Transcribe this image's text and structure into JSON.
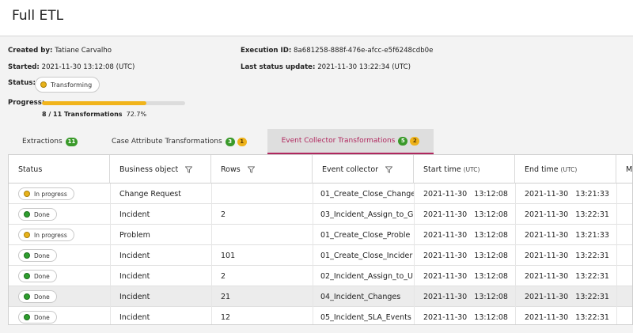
{
  "page": {
    "title": "Full ETL"
  },
  "info": {
    "created_by_label": "Created by:",
    "created_by": "Tatiane Carvalho",
    "started_label": "Started:",
    "started": "2021-11-30  13:12:08 (UTC)",
    "status_label": "Status:",
    "status": "Transforming",
    "progress_label": "Progress:",
    "execution_id_label": "Execution ID:",
    "execution_id": "8a681258-888f-476e-afcc-e5f6248cdb0e",
    "last_update_label": "Last status update:",
    "last_update": "2021-11-30  13:22:34 (UTC)"
  },
  "progress": {
    "fraction": 0.727,
    "count_text": "8 / 11 Transformations",
    "percent_text": "72.7%"
  },
  "tabs": [
    {
      "label": "Extractions",
      "badges": [
        "11"
      ]
    },
    {
      "label": "Case Attribute Transformations",
      "badges": [
        "3",
        "1"
      ]
    },
    {
      "label": "Event Collector Transformations",
      "badges": [
        "5",
        "2"
      ]
    }
  ],
  "table": {
    "headers": [
      "Status",
      "Business object",
      "Rows",
      "Event collector",
      "Start time",
      "End time",
      "Me"
    ],
    "header_unit": "(UTC)",
    "rows": [
      {
        "status": "In progress",
        "business_object": "Change Request",
        "rows": "",
        "event_collector": "01_Create_Close_Change",
        "start": "2021-11-30   13:12:08",
        "end": "2021-11-30   13:21:33"
      },
      {
        "status": "Done",
        "business_object": "Incident",
        "rows": "2",
        "event_collector": "03_Incident_Assign_to_G",
        "start": "2021-11-30   13:12:08",
        "end": "2021-11-30   13:22:31"
      },
      {
        "status": "In progress",
        "business_object": "Problem",
        "rows": "",
        "event_collector": "01_Create_Close_Proble",
        "start": "2021-11-30   13:12:08",
        "end": "2021-11-30   13:21:33"
      },
      {
        "status": "Done",
        "business_object": "Incident",
        "rows": "101",
        "event_collector": "01_Create_Close_Incider",
        "start": "2021-11-30   13:12:08",
        "end": "2021-11-30   13:22:31"
      },
      {
        "status": "Done",
        "business_object": "Incident",
        "rows": "2",
        "event_collector": "02_Incident_Assign_to_U",
        "start": "2021-11-30   13:12:08",
        "end": "2021-11-30   13:22:31"
      },
      {
        "status": "Done",
        "business_object": "Incident",
        "rows": "21",
        "event_collector": "04_Incident_Changes",
        "start": "2021-11-30   13:12:08",
        "end": "2021-11-30   13:22:31"
      },
      {
        "status": "Done",
        "business_object": "Incident",
        "rows": "12",
        "event_collector": "05_Incident_SLA_Events",
        "start": "2021-11-30   13:12:08",
        "end": "2021-11-30   13:22:31"
      }
    ]
  },
  "colors": {
    "accent": "#b0275e",
    "progress": "#f1b41b",
    "done": "#2e9e2e",
    "in_progress": "#e8b21a"
  }
}
